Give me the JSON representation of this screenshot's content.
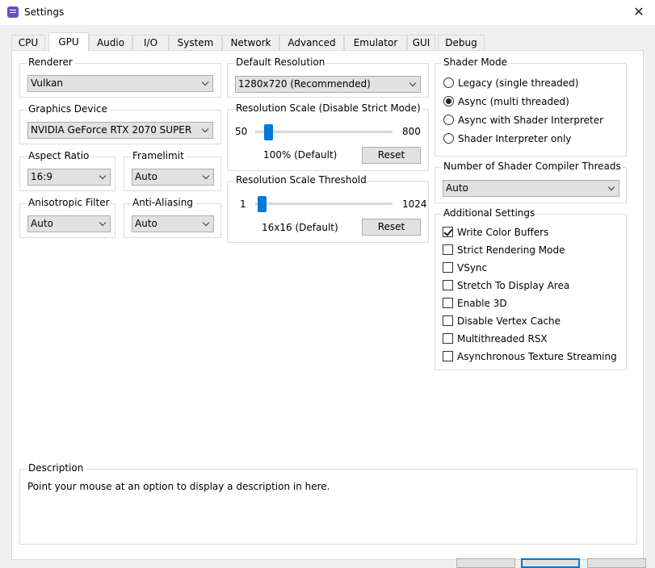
{
  "window": {
    "title": "Settings",
    "close_glyph": "✕"
  },
  "tabs": [
    "CPU",
    "GPU",
    "Audio",
    "I/O",
    "System",
    "Network",
    "Advanced",
    "Emulator",
    "GUI",
    "Debug"
  ],
  "active_tab": "GPU",
  "renderer": {
    "title": "Renderer",
    "value": "Vulkan"
  },
  "graphics_device": {
    "title": "Graphics Device",
    "value": "NVIDIA GeForce RTX 2070 SUPER"
  },
  "aspect_ratio": {
    "title": "Aspect Ratio",
    "value": "16:9"
  },
  "framelimit": {
    "title": "Framelimit",
    "value": "Auto"
  },
  "anisotropic_filter": {
    "title": "Anisotropic Filter",
    "value": "Auto"
  },
  "anti_aliasing": {
    "title": "Anti-Aliasing",
    "value": "Auto"
  },
  "default_resolution": {
    "title": "Default Resolution",
    "value": "1280x720 (Recommended)"
  },
  "resolution_scale": {
    "title": "Resolution Scale (Disable Strict Mode)",
    "min_label": "50",
    "max_label": "800",
    "value_text": "100% (Default)",
    "reset_label": "Reset",
    "level": 0.07
  },
  "resolution_threshold": {
    "title": "Resolution Scale Threshold",
    "min_label": "1",
    "max_label": "1024",
    "value_text": "16x16 (Default)",
    "reset_label": "Reset",
    "level": 0.02
  },
  "shader_mode": {
    "title": "Shader Mode",
    "options": [
      {
        "label": "Legacy (single threaded)",
        "selected": false
      },
      {
        "label": "Async (multi threaded)",
        "selected": true
      },
      {
        "label": "Async with Shader Interpreter",
        "selected": false
      },
      {
        "label": "Shader Interpreter only",
        "selected": false
      }
    ]
  },
  "shader_threads": {
    "title": "Number of Shader Compiler Threads",
    "value": "Auto"
  },
  "additional": {
    "title": "Additional Settings",
    "items": [
      {
        "label": "Write Color Buffers",
        "checked": true
      },
      {
        "label": "Strict Rendering Mode",
        "checked": false
      },
      {
        "label": "VSync",
        "checked": false
      },
      {
        "label": "Stretch To Display Area",
        "checked": false
      },
      {
        "label": "Enable 3D",
        "checked": false
      },
      {
        "label": "Disable Vertex Cache",
        "checked": false
      },
      {
        "label": "Multithreaded RSX",
        "checked": false
      },
      {
        "label": "Asynchronous Texture Streaming",
        "checked": false
      }
    ]
  },
  "description": {
    "title": "Description",
    "text": "Point your mouse at an option to display a description in here."
  }
}
